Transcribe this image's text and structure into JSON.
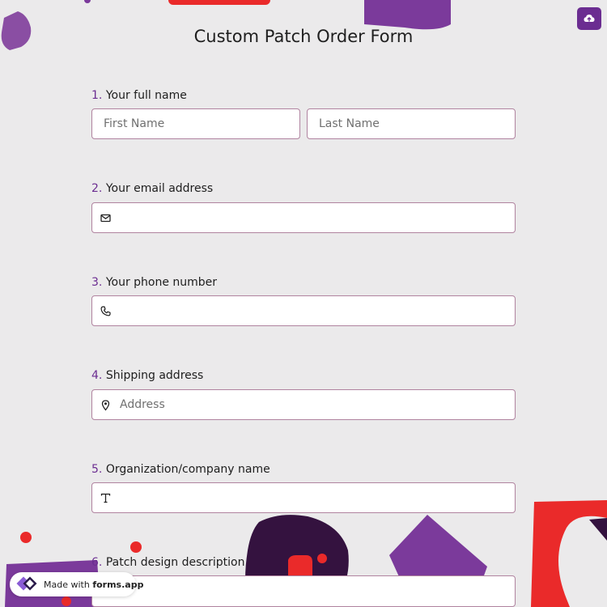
{
  "form": {
    "title": "Custom Patch Order Form"
  },
  "toolbar": {
    "upload_icon": "cloud-upload-icon"
  },
  "questions": [
    {
      "number": "1.",
      "label": "Your full name",
      "fields": [
        {
          "placeholder": "First Name",
          "value": ""
        },
        {
          "placeholder": "Last Name",
          "value": ""
        }
      ]
    },
    {
      "number": "2.",
      "label": "Your email address",
      "icon": "envelope-icon",
      "placeholder": "",
      "value": ""
    },
    {
      "number": "3.",
      "label": "Your phone number",
      "icon": "phone-icon",
      "placeholder": "",
      "value": ""
    },
    {
      "number": "4.",
      "label": "Shipping address",
      "icon": "map-pin-icon",
      "placeholder": "Address",
      "value": ""
    },
    {
      "number": "5.",
      "label": "Organization/company name",
      "icon": "text-t-icon",
      "placeholder": "",
      "value": ""
    },
    {
      "number": "6.",
      "label": "Patch design description",
      "placeholder": "",
      "value": ""
    }
  ],
  "footer": {
    "made_with": "Made with",
    "brand": "forms.app",
    "logo_icon": "forms-app-logo-icon"
  },
  "colors": {
    "accent": "#6b2d91",
    "background": "#ebeaeb",
    "decor_red": "#ea2a2a",
    "decor_purple": "#7b3a9b",
    "decor_dark": "#34123f"
  }
}
